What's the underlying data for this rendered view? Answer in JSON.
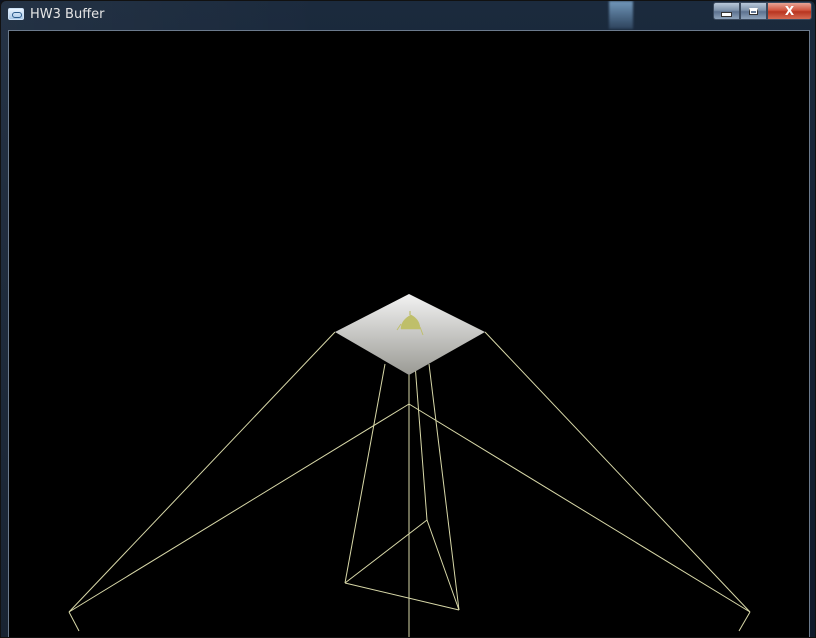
{
  "window": {
    "title": "HW3 Buffer",
    "icon": "opengl-window-icon",
    "close_glyph": "X"
  },
  "scene": {
    "background": "#000000",
    "wire_color": "#d8d8a8",
    "plane_color_light": "#f2f2f2",
    "plane_color_dark": "#9a9a94",
    "teapot_color": "#bfbf6a"
  }
}
